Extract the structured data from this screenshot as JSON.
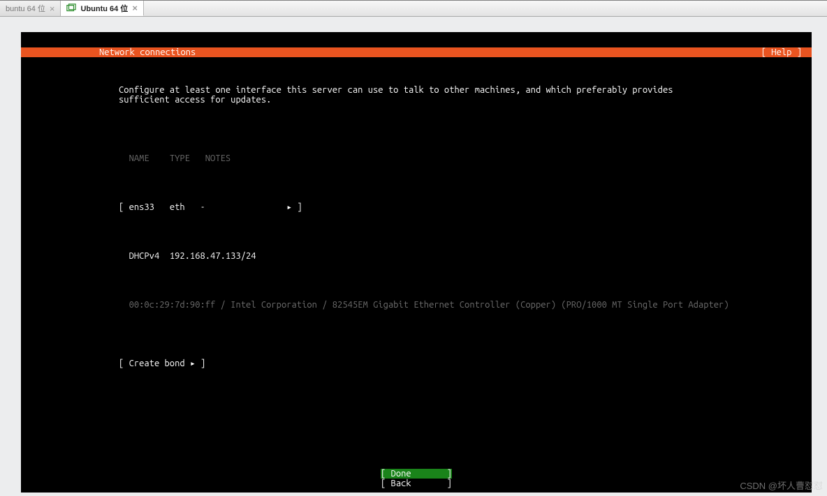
{
  "host": {
    "tabs": [
      {
        "label": "buntu 64 位",
        "active": false
      },
      {
        "label": "Ubuntu 64 位",
        "active": true
      }
    ],
    "close_glyph": "×"
  },
  "installer": {
    "title": "Network connections",
    "help_label": "[ Help ]",
    "description": "Configure at least one interface this server can use to talk to other machines, and which preferably provides sufficient access for updates.",
    "columns": {
      "name": "NAME",
      "type": "TYPE",
      "notes": "NOTES"
    },
    "interfaces": [
      {
        "name": "ens33",
        "type": "eth",
        "notes": "-",
        "arrow": "▸",
        "dhcp_label": "DHCPv4",
        "ip": "192.168.47.133/24",
        "hw_info": "00:0c:29:7d:90:ff / Intel Corporation / 82545EM Gigabit Ethernet Controller (Copper) (PRO/1000 MT Single Port Adapter)"
      }
    ],
    "create_bond_label": "Create bond",
    "create_bond_arrow": "▸",
    "done_label": "Done",
    "back_label": "Back"
  },
  "watermark": "CSDN @坏人曹怼怼"
}
